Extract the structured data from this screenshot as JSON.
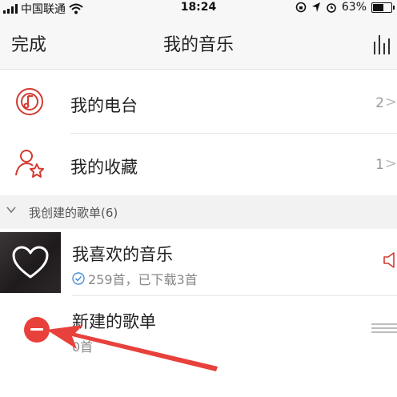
{
  "status_bar": {
    "carrier": "中国联通",
    "time": "18:24",
    "battery": "63%",
    "battery_level": 0.63
  },
  "nav": {
    "done_label": "完成",
    "title": "我的音乐"
  },
  "menu_items": [
    {
      "label": "我的电台",
      "count": "2",
      "icon": "radio-icon"
    },
    {
      "label": "我的收藏",
      "count": "1",
      "icon": "user-star-icon"
    }
  ],
  "section": {
    "title": "我创建的歌单(6)"
  },
  "playlists": [
    {
      "title": "我喜欢的音乐",
      "subtitle": "259首，已下载3首",
      "icon": "heart-icon"
    },
    {
      "title": "新建的歌单",
      "subtitle": "0首"
    }
  ],
  "colors": {
    "accent": "#d33a31",
    "delete": "#e8413c",
    "section_bg": "#f2f2f2"
  }
}
